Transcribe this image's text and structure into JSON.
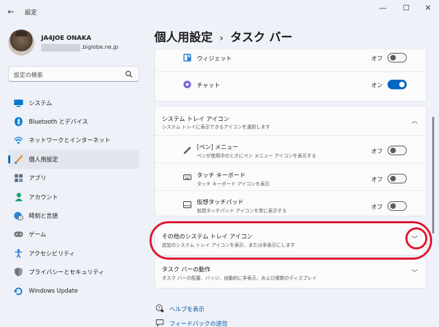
{
  "window": {
    "title": "設定",
    "back_icon": "back-arrow-icon",
    "controls": [
      "—",
      "☐",
      "✕"
    ]
  },
  "user": {
    "name": "JA4JOE ONAKA",
    "email_suffix": ".biglobe.ne.jp"
  },
  "search": {
    "placeholder": "設定の検索"
  },
  "sidebar": {
    "items": [
      {
        "label": "システム",
        "icon": "system-icon",
        "color": "#0078d4"
      },
      {
        "label": "Bluetooth とデバイス",
        "icon": "bluetooth-icon",
        "color": "#0078d4"
      },
      {
        "label": "ネットワークとインターネット",
        "icon": "wifi-icon",
        "color": "#0078d4"
      },
      {
        "label": "個人用設定",
        "icon": "brush-icon",
        "color": "#e08a2a",
        "active": true
      },
      {
        "label": "アプリ",
        "icon": "apps-icon",
        "color": "#5a6b82"
      },
      {
        "label": "アカウント",
        "icon": "account-icon",
        "color": "#1a9e74"
      },
      {
        "label": "時刻と言語",
        "icon": "globe-clock-icon",
        "color": "#0078d4"
      },
      {
        "label": "ゲーム",
        "icon": "gamepad-icon",
        "color": "#6b6b6b"
      },
      {
        "label": "アクセシビリティ",
        "icon": "accessibility-icon",
        "color": "#2a7ad6"
      },
      {
        "label": "プライバシーとセキュリティ",
        "icon": "shield-icon",
        "color": "#6b7280"
      },
      {
        "label": "Windows Update",
        "icon": "update-icon",
        "color": "#0078d4"
      }
    ]
  },
  "breadcrumb": {
    "parent": "個人用設定",
    "separator": "›",
    "current": "タスク バー"
  },
  "taskbar_items": {
    "widgets": {
      "label": "ウィジェット",
      "state": "オフ"
    },
    "chat": {
      "label": "チャット",
      "state": "オン"
    }
  },
  "tray_section": {
    "title": "システム トレイ アイコン",
    "subtitle": "システム トレイに表示できるアイコンを選択します",
    "items": [
      {
        "title": "[ペン] メニュー",
        "subtitle": "ペンが使用中のときにペン メニュー アイコンを表示する",
        "state": "オフ",
        "icon": "pen-icon"
      },
      {
        "title": "タッチ キーボード",
        "subtitle": "タッチ キーボード アイコンを表示",
        "state": "オフ",
        "icon": "keyboard-icon"
      },
      {
        "title": "仮想タッチパッド",
        "subtitle": "仮想タッチパッド アイコンを常に表示する",
        "state": "オフ",
        "icon": "touchpad-icon"
      }
    ]
  },
  "other_tray": {
    "title": "その他のシステム トレイ アイコン",
    "subtitle": "追加のシステム トレイ アイコンを表示、または非表示にします"
  },
  "behavior": {
    "title": "タスク バーの動作",
    "subtitle": "タスク バーの配置、バッジ、自動的に非表示、および複数のディスプレイ"
  },
  "links": {
    "help": "ヘルプを表示",
    "feedback": "フィードバックの送信"
  },
  "colors": {
    "accent": "#0067c0",
    "highlight": "#e0162b"
  }
}
